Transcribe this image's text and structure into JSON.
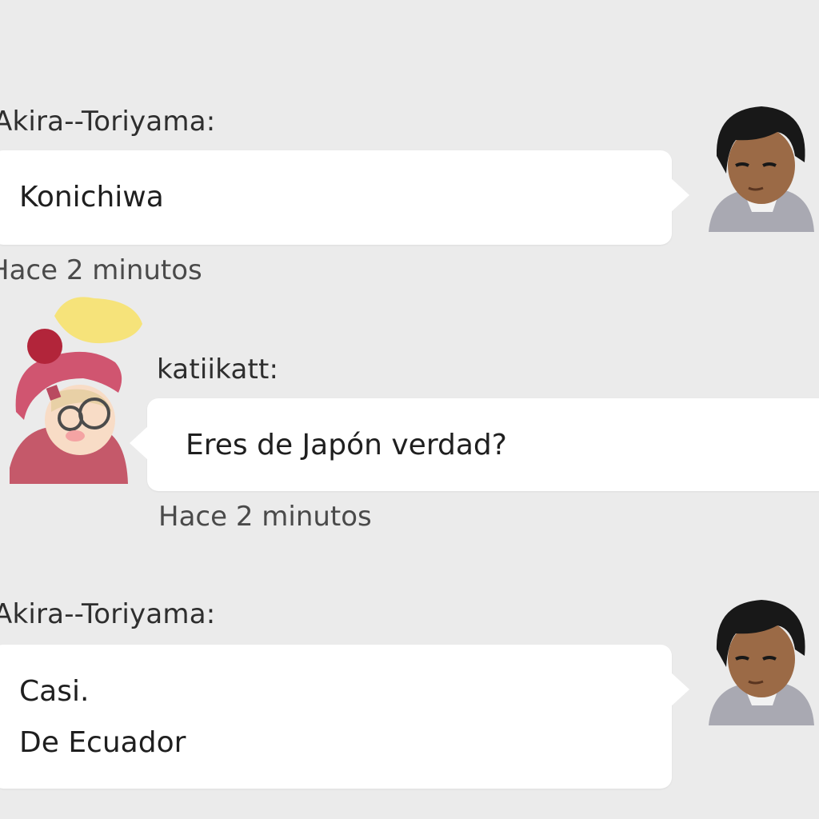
{
  "messages": [
    {
      "sender": "Akira--Toriyama:",
      "lines": [
        "Konichiwa"
      ],
      "time": "Hace 2 minutos",
      "avatar": "boy-avatar-icon"
    },
    {
      "sender": "katiikatt:",
      "lines": [
        "Eres de Japón verdad?"
      ],
      "time": "Hace 2 minutos",
      "avatar": "girl-avatar-icon"
    },
    {
      "sender": "Akira--Toriyama:",
      "lines": [
        "Casi.",
        "De Ecuador"
      ],
      "time": "",
      "avatar": "boy-avatar-icon"
    }
  ],
  "colors": {
    "background": "#ebebeb",
    "bubble": "#ffffff",
    "text": "#1f1f1f"
  }
}
